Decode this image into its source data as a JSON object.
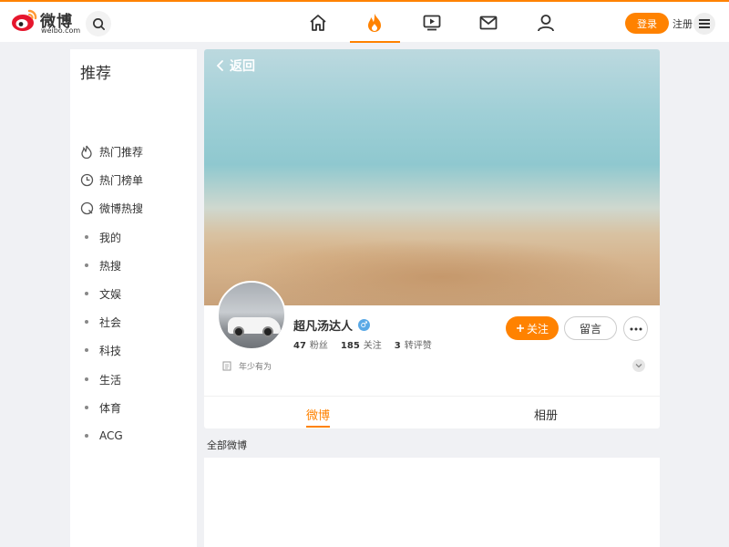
{
  "header": {
    "logo_text": "微博",
    "logo_sub": "weibo.com",
    "login_label": "登录",
    "register_label": "注册",
    "nav": [
      "home-icon",
      "hot-icon",
      "video-icon",
      "mail-icon",
      "user-icon"
    ],
    "active_nav": "hot-icon",
    "accent_color": "#ff8200"
  },
  "sidebar": {
    "title": "推荐",
    "items": [
      {
        "label": "热门推荐",
        "icon": "flame-icon"
      },
      {
        "label": "热门榜单",
        "icon": "clock-icon"
      },
      {
        "label": "微博热搜",
        "icon": "search-circle-icon"
      },
      {
        "label": "我的",
        "icon": "bullet"
      },
      {
        "label": "热搜",
        "icon": "bullet"
      },
      {
        "label": "文娱",
        "icon": "bullet"
      },
      {
        "label": "社会",
        "icon": "bullet"
      },
      {
        "label": "科技",
        "icon": "bullet"
      },
      {
        "label": "生活",
        "icon": "bullet"
      },
      {
        "label": "体育",
        "icon": "bullet"
      },
      {
        "label": "ACG",
        "icon": "bullet"
      }
    ]
  },
  "profile": {
    "back_label": "返回",
    "name": "超凡汤达人",
    "gender": "♂",
    "followers_count": "47",
    "followers_label": "粉丝",
    "following_count": "185",
    "following_label": "关注",
    "likes_count": "3",
    "likes_label": "转评赞",
    "follow_label": "关注",
    "message_label": "留言",
    "bio": "年少有为"
  },
  "tabs": [
    {
      "label": "微博",
      "active": true
    },
    {
      "label": "相册",
      "active": false
    }
  ],
  "feed": {
    "section_label": "全部微博"
  }
}
